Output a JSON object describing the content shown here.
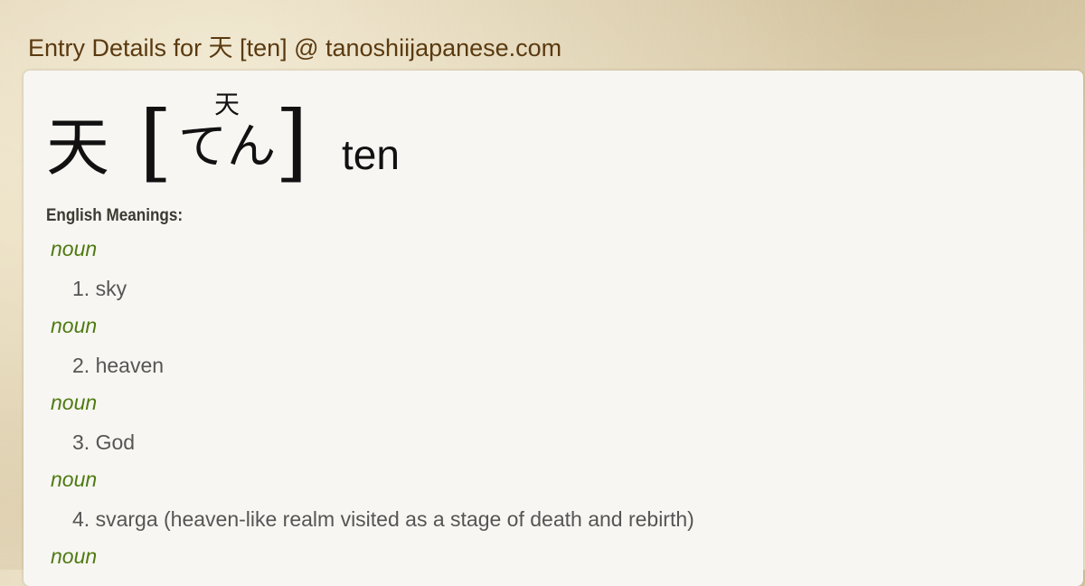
{
  "page": {
    "title": "Entry Details for 天 [ten] @ tanoshiijapanese.com"
  },
  "entry": {
    "kanji": "天",
    "bracket_open": "[",
    "bracket_close": "]",
    "furigana": "天",
    "reading": "てん",
    "romaji": "ten"
  },
  "meanings": {
    "label": "English Meanings:",
    "senses": [
      {
        "pos": "noun",
        "gloss": "1. sky"
      },
      {
        "pos": "noun",
        "gloss": "2. heaven"
      },
      {
        "pos": "noun",
        "gloss": "3. God"
      },
      {
        "pos": "noun",
        "gloss": "4. svarga (heaven-like realm visited as a stage of death and rebirth)"
      },
      {
        "pos": "noun",
        "gloss": ""
      }
    ]
  },
  "colors": {
    "title": "#5a3a10",
    "pos": "#4f7a12",
    "gloss": "#555555",
    "card": "#f7f6f2"
  }
}
